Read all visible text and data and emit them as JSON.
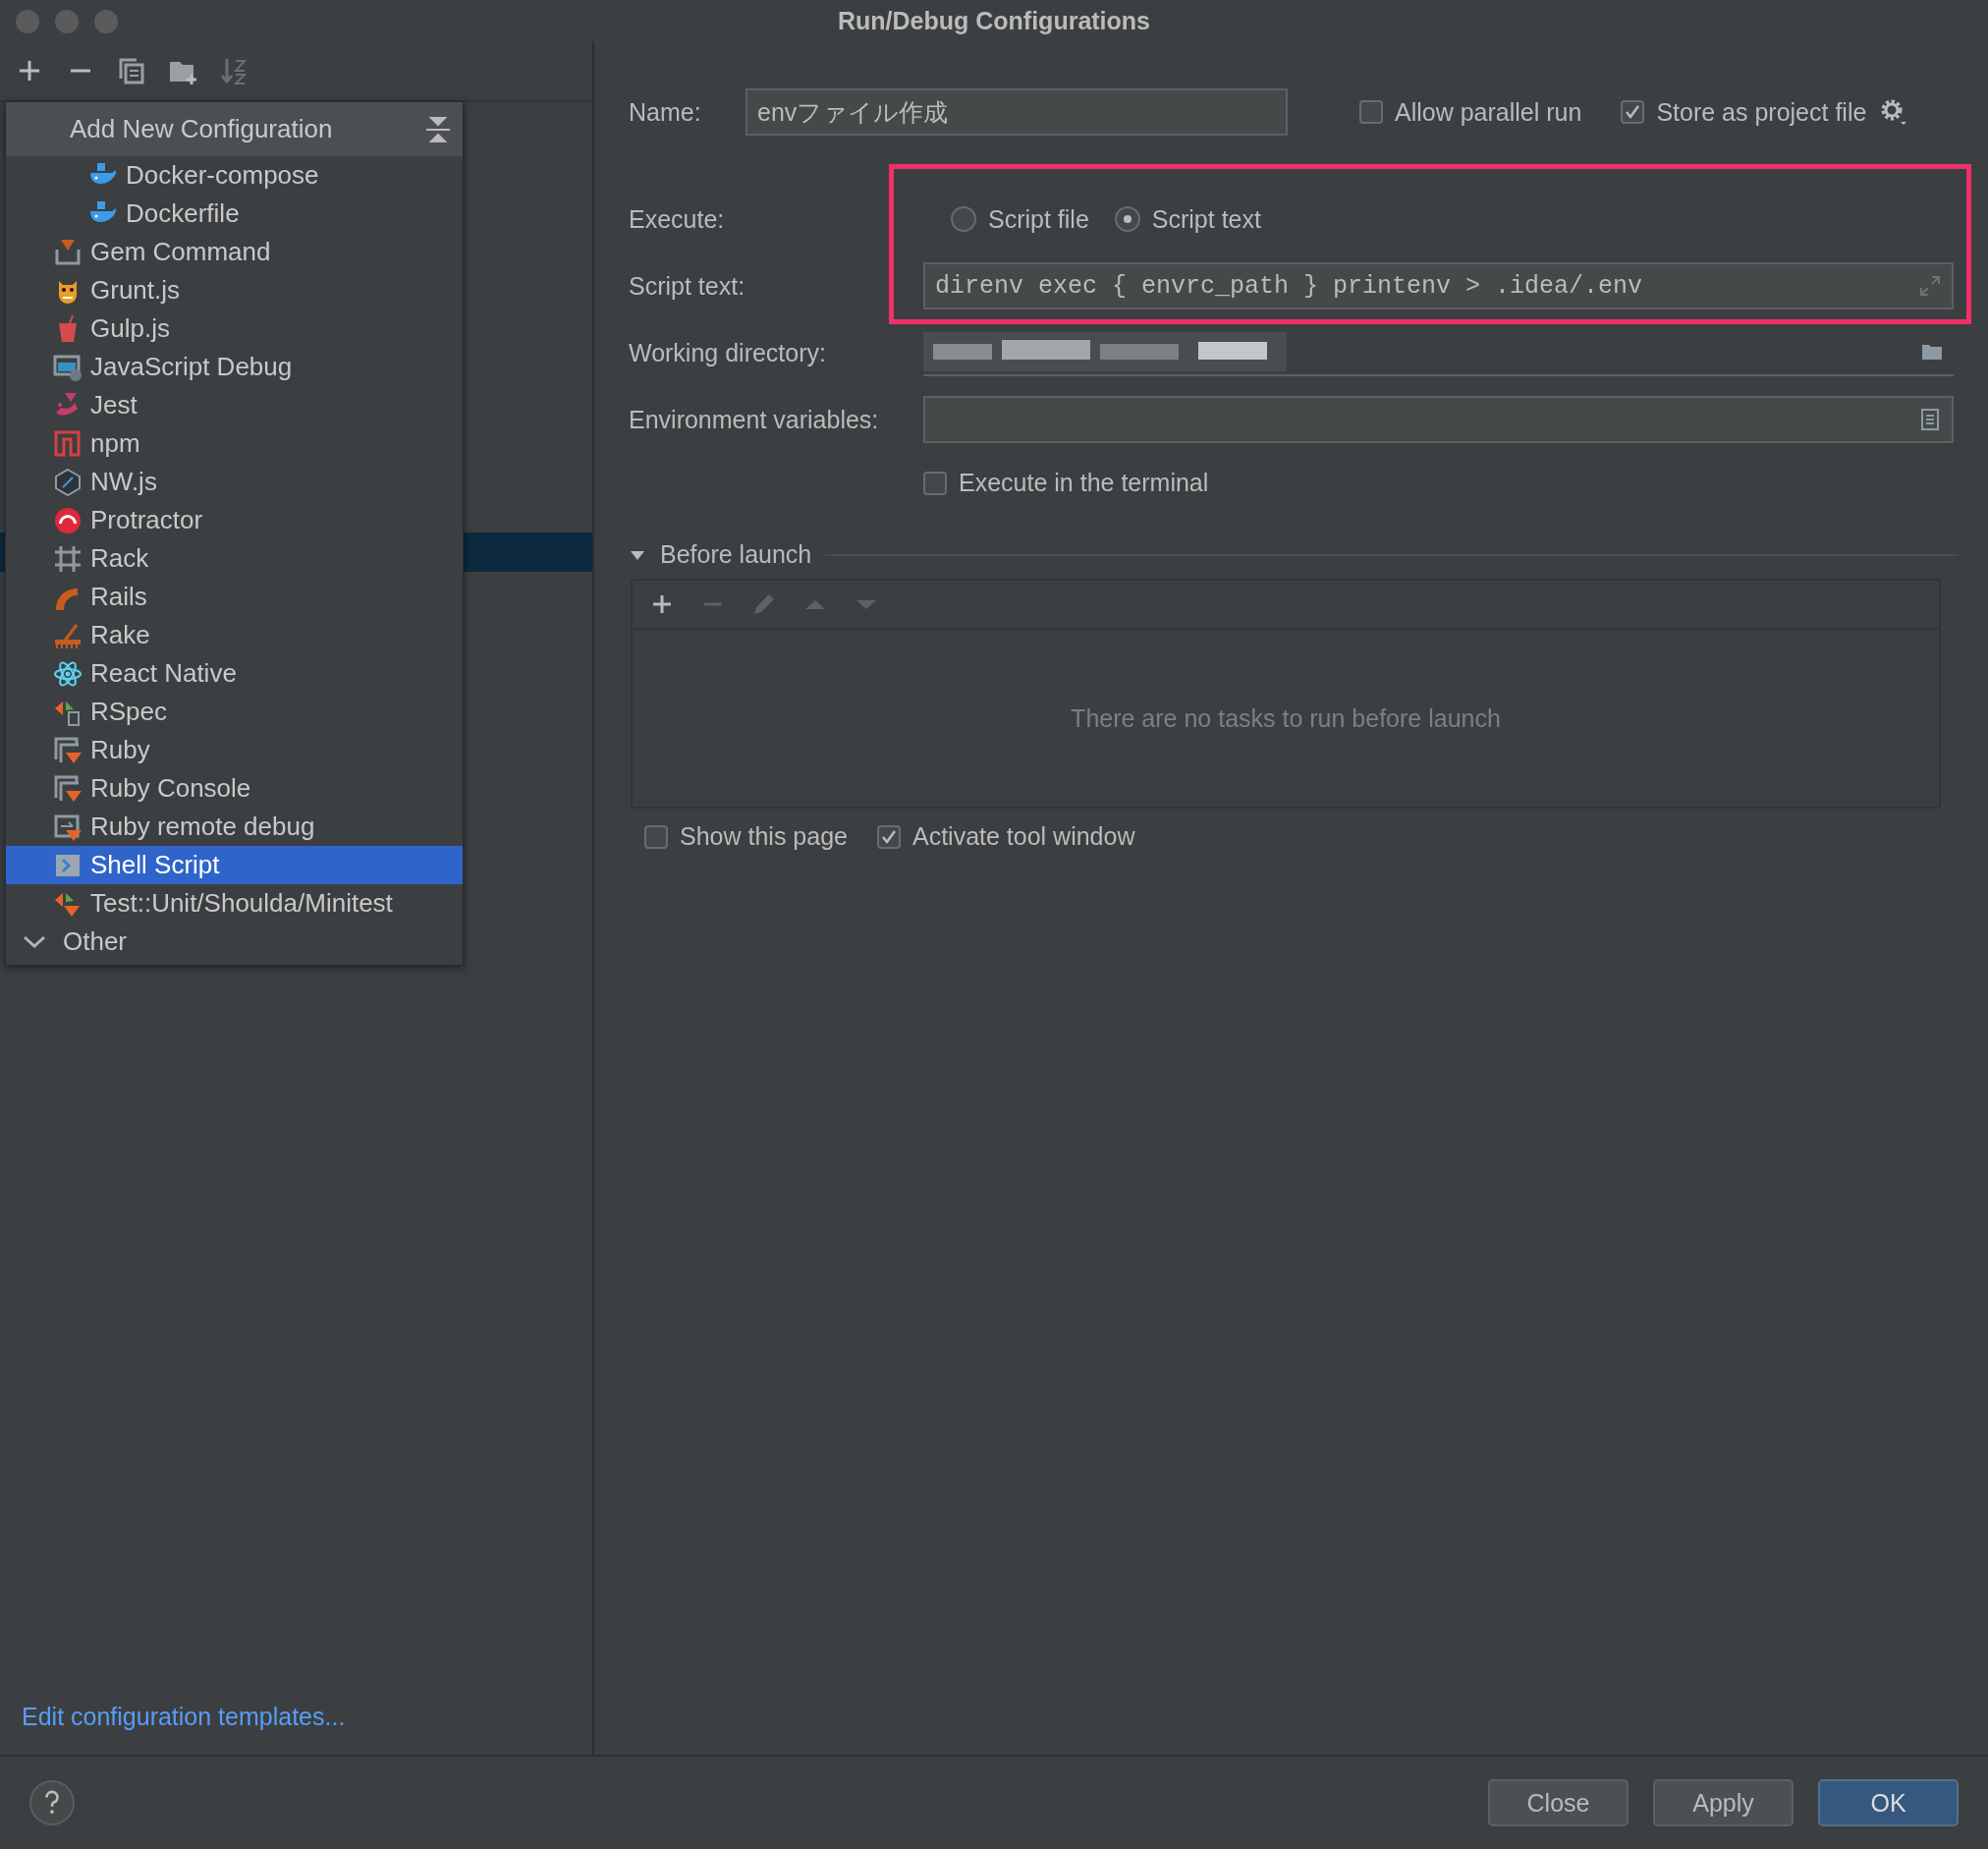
{
  "window": {
    "title": "Run/Debug Configurations"
  },
  "popup": {
    "title": "Add New Configuration",
    "items": [
      {
        "label": "Docker-compose",
        "kind": "docker",
        "selected": false
      },
      {
        "label": "Dockerfile",
        "kind": "docker",
        "selected": false
      },
      {
        "label": "Gem Command",
        "kind": "gem",
        "selected": false
      },
      {
        "label": "Grunt.js",
        "kind": "grunt",
        "selected": false
      },
      {
        "label": "Gulp.js",
        "kind": "gulp",
        "selected": false
      },
      {
        "label": "JavaScript Debug",
        "kind": "jsdebug",
        "selected": false
      },
      {
        "label": "Jest",
        "kind": "jest",
        "selected": false
      },
      {
        "label": "npm",
        "kind": "npm",
        "selected": false
      },
      {
        "label": "NW.js",
        "kind": "nwjs",
        "selected": false
      },
      {
        "label": "Protractor",
        "kind": "protractor",
        "selected": false
      },
      {
        "label": "Rack",
        "kind": "rack",
        "selected": false
      },
      {
        "label": "Rails",
        "kind": "rails",
        "selected": false
      },
      {
        "label": "Rake",
        "kind": "rake",
        "selected": false
      },
      {
        "label": "React Native",
        "kind": "react",
        "selected": false
      },
      {
        "label": "RSpec",
        "kind": "rspec",
        "selected": false
      },
      {
        "label": "Ruby",
        "kind": "ruby",
        "selected": false
      },
      {
        "label": "Ruby Console",
        "kind": "ruby",
        "selected": false
      },
      {
        "label": "Ruby remote debug",
        "kind": "rubyremote",
        "selected": false
      },
      {
        "label": "Shell Script",
        "kind": "shell",
        "selected": true
      },
      {
        "label": "Test::Unit/Shoulda/Minitest",
        "kind": "test",
        "selected": false
      },
      {
        "label": "Other",
        "kind": "group",
        "selected": false
      }
    ]
  },
  "templates_link": "Edit configuration templates...",
  "form": {
    "name_label": "Name:",
    "name_value": "envファイル作成",
    "options": [
      {
        "label": "Allow parallel run",
        "checked": false
      },
      {
        "label": "Store as project file",
        "checked": true
      }
    ],
    "execute_label": "Execute:",
    "execute_options": [
      {
        "label": "Script file",
        "selected": false
      },
      {
        "label": "Script text",
        "selected": true
      }
    ],
    "script_label": "Script text:",
    "script_value": "direnv exec { envrc_path } printenv > .idea/.env",
    "workdir_label": "Working directory:",
    "workdir_redacted": true,
    "env_label": "Environment variables:",
    "terminal": {
      "label": "Execute in the terminal",
      "checked": false
    },
    "highlighted": true
  },
  "before_launch": {
    "title": "Before launch",
    "expanded": true,
    "empty_text": "There are no tasks to run before launch"
  },
  "footer_options": [
    {
      "label": "Show this page",
      "checked": false
    },
    {
      "label": "Activate tool window",
      "checked": true
    }
  ],
  "buttons": [
    {
      "label": "Close",
      "default": false
    },
    {
      "label": "Apply",
      "default": false
    },
    {
      "label": "OK",
      "default": true
    }
  ]
}
